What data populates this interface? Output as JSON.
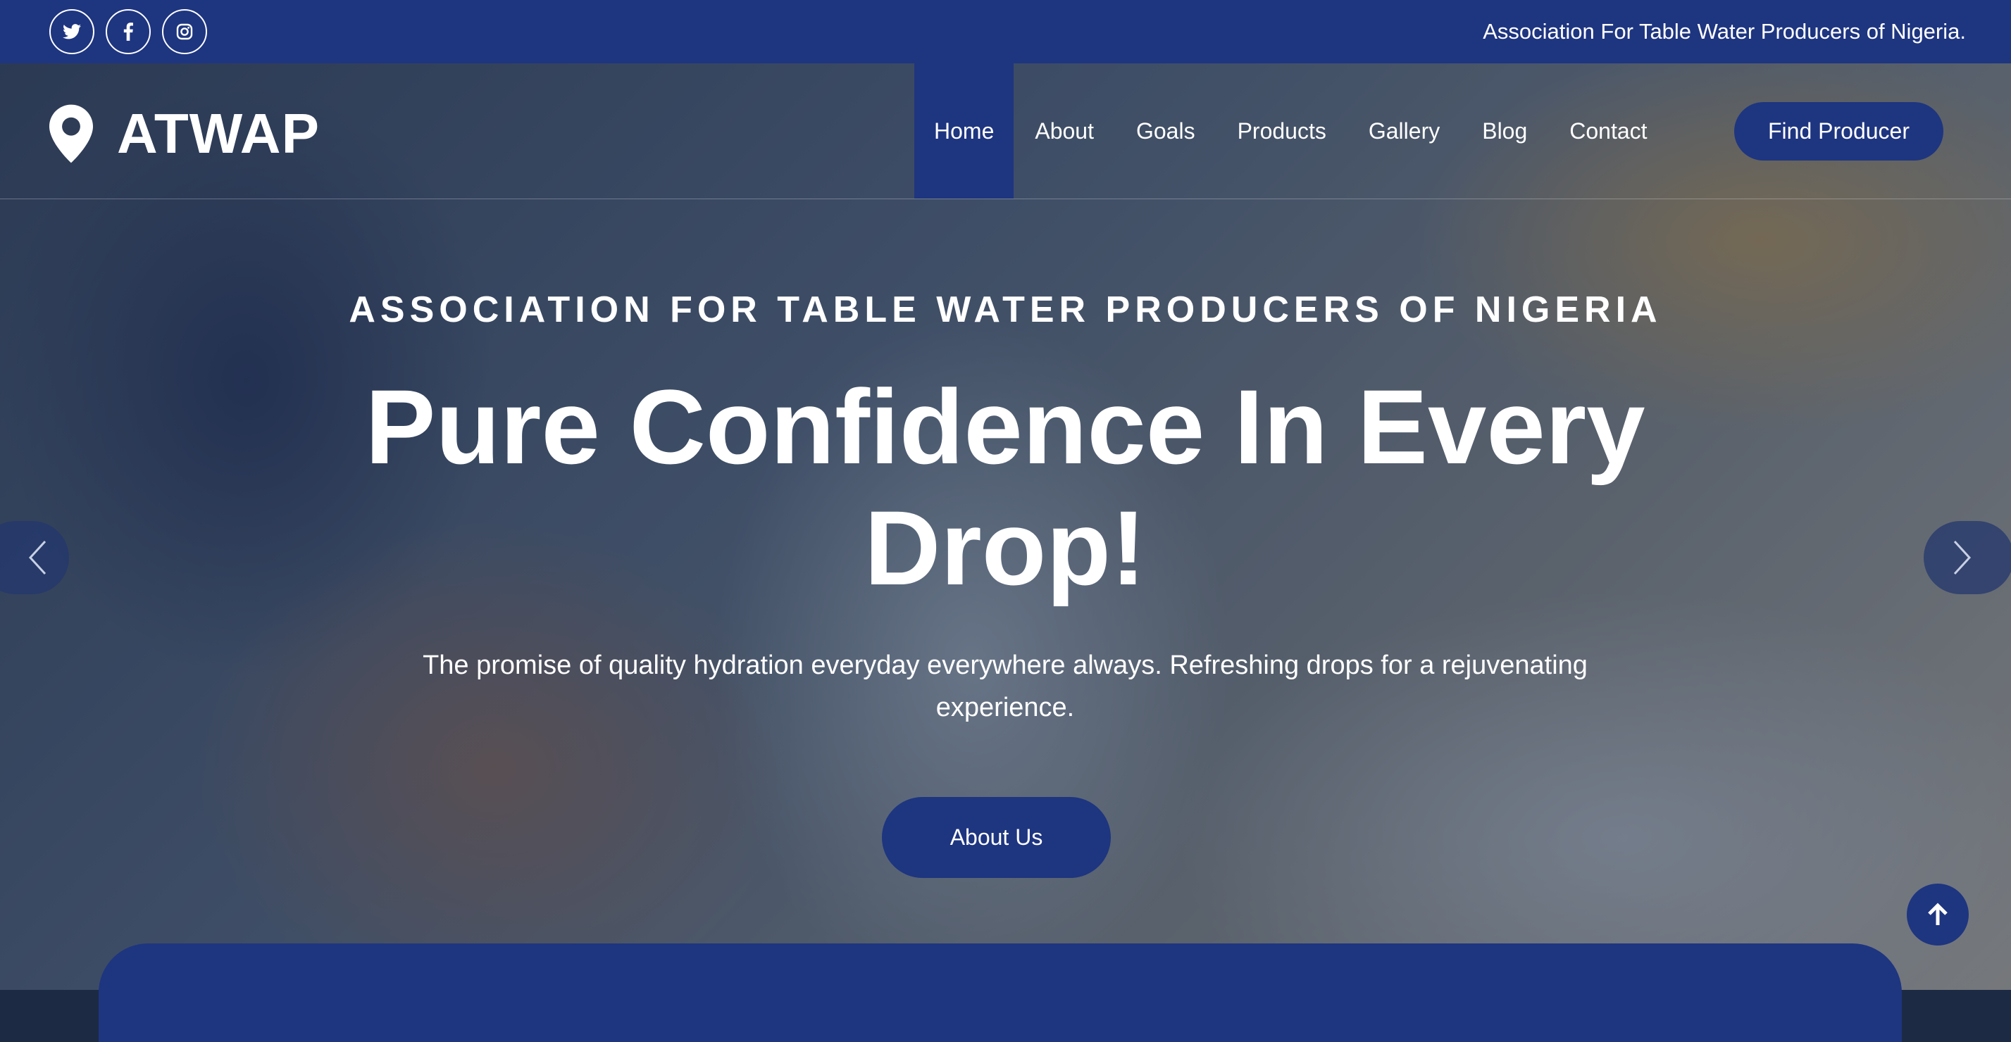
{
  "topbar": {
    "tagline": "Association For Table Water Producers of Nigeria.",
    "socials": [
      {
        "icon": "twitter-icon"
      },
      {
        "icon": "facebook-icon"
      },
      {
        "icon": "instagram-icon"
      }
    ]
  },
  "brand": {
    "name": "ATWAP",
    "icon": "map-pin-icon"
  },
  "nav": {
    "items": [
      {
        "label": "Home",
        "active": true
      },
      {
        "label": "About"
      },
      {
        "label": "Goals"
      },
      {
        "label": "Products"
      },
      {
        "label": "Gallery"
      },
      {
        "label": "Blog"
      },
      {
        "label": "Contact"
      }
    ],
    "cta_label": "Find Producer"
  },
  "hero": {
    "eyebrow": "ASSOCIATION FOR TABLE WATER PRODUCERS OF NIGERIA",
    "headline": "Pure Confidence In Every Drop!",
    "subtext": "The promise of quality hydration everyday everywhere always. Refreshing drops for a rejuvenating experience.",
    "button_label": "About Us"
  },
  "colors": {
    "primary": "#1e3580",
    "text": "#ffffff"
  },
  "icons": {
    "prev": "chevron-left-icon",
    "next": "chevron-right-icon",
    "back_to_top": "arrow-up-icon"
  }
}
